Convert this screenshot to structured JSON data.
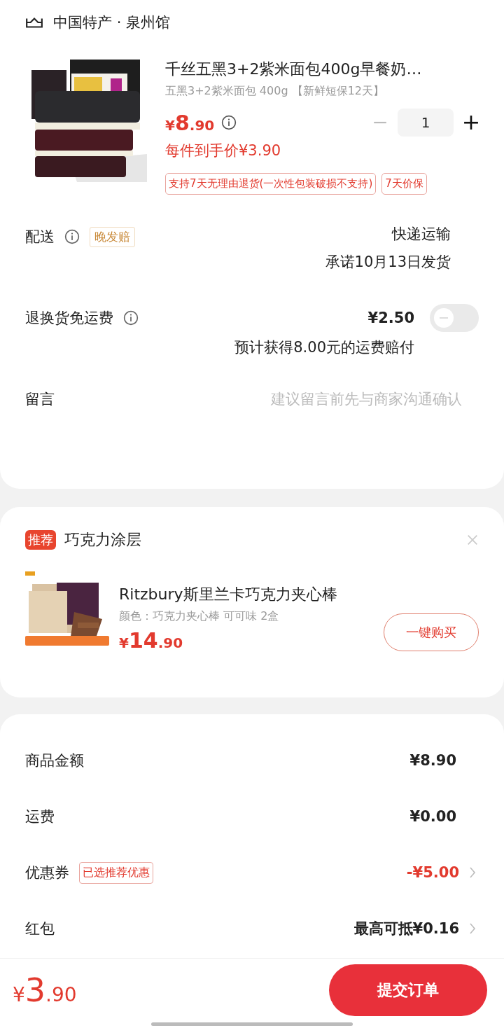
{
  "store": {
    "name": "中国特产 · 泉州馆"
  },
  "product": {
    "title": "千丝五黑3+2紫米面包400g早餐奶…",
    "spec": "五黑3+2紫米面包 400g 【新鲜短保12天】",
    "price": "¥8.90",
    "quantity": "1",
    "final_price": "每件到手价¥3.90",
    "tags": [
      "支持7天无理由退货(一次性包装破损不支持)",
      "7天价保"
    ]
  },
  "delivery": {
    "label": "配送",
    "badge": "晚发赔",
    "method": "快递运输",
    "promise": "承诺10月13日发货"
  },
  "return_insurance": {
    "label": "退换货免运费",
    "price": "¥2.50",
    "on": false,
    "note": "预计获得8.00元的运费赔付"
  },
  "message": {
    "label": "留言",
    "placeholder": "建议留言前先与商家沟通确认"
  },
  "recommendation": {
    "badge": "推荐",
    "title": "巧克力涂层",
    "product": {
      "name": "Ritzbury斯里兰卡巧克力夹心棒",
      "spec": "颜色：巧克力夹心棒 可可味 2盒",
      "price": "¥14.90",
      "button": "一键购买"
    }
  },
  "summary": [
    {
      "kind": "plain",
      "label": "商品金额",
      "value": "¥8.90"
    },
    {
      "kind": "plain",
      "label": "运费",
      "value": "¥0.00"
    },
    {
      "kind": "discount",
      "label": "优惠券",
      "badge": "已选推荐优惠",
      "value": "-¥5.00"
    },
    {
      "kind": "link",
      "label": "红包",
      "value": "最高可抵¥0.16"
    }
  ],
  "footer": {
    "total": "¥3.90",
    "submit": "提交订单"
  }
}
